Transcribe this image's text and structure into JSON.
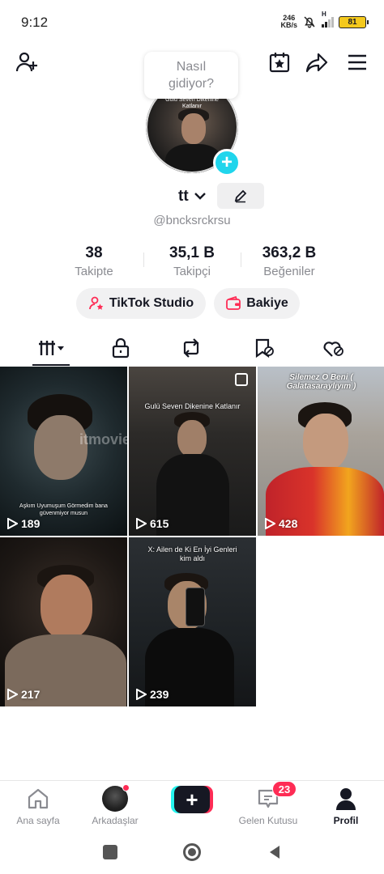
{
  "status_bar": {
    "time": "9:12",
    "net_speed_value": "246",
    "net_speed_unit": "KB/s",
    "network_type": "H",
    "battery": "81"
  },
  "header": {
    "add_friend_icon": "add-user-icon",
    "calendar_icon": "calendar-star-icon",
    "share_icon": "share-icon",
    "menu_icon": "hamburger-menu-icon",
    "status_bubble": "Nasıl gidiyor?"
  },
  "profile": {
    "avatar_caption": "Gulü Seven Dikenine Katlanır",
    "display_name": "tt",
    "handle": "@bncksrckrsu"
  },
  "stats": [
    {
      "value": "38",
      "label": "Takipte"
    },
    {
      "value": "35,1 B",
      "label": "Takipçi"
    },
    {
      "value": "363,2 B",
      "label": "Beğeniler"
    }
  ],
  "actions": {
    "studio_label": "TikTok Studio",
    "balance_label": "Bakiye"
  },
  "tabs": [
    {
      "name": "videos",
      "icon": "grid-filter-icon"
    },
    {
      "name": "private",
      "icon": "lock-icon"
    },
    {
      "name": "reposts",
      "icon": "repost-icon"
    },
    {
      "name": "favorites",
      "icon": "bookmark-icon"
    },
    {
      "name": "liked",
      "icon": "liked-heart-icon"
    }
  ],
  "videos": [
    {
      "views": "189",
      "caption": "Aşkım Uyumuşum Görmedim bana güvenmiyor musun",
      "watermark": "itmovie",
      "pinned": false
    },
    {
      "views": "615",
      "caption": "Gulü Seven Dikenine Katlanır",
      "pinned": true
    },
    {
      "views": "428",
      "caption": "Silemez O Beni ( Galatasaraylıyım )",
      "pinned": false
    },
    {
      "views": "217",
      "caption": "",
      "pinned": false
    },
    {
      "views": "239",
      "caption": "X: Ailen de Ki En İyi Genleri kim aldı",
      "pinned": false
    }
  ],
  "bottom_nav": {
    "home": "Ana sayfa",
    "friends": "Arkadaşlar",
    "inbox": "Gelen Kutusu",
    "inbox_badge": "23",
    "profile": "Profil"
  },
  "colors": {
    "accent_cyan": "#20d5ec",
    "accent_red": "#fe2c55",
    "text_primary": "#161823",
    "text_secondary": "#8a8b91"
  }
}
